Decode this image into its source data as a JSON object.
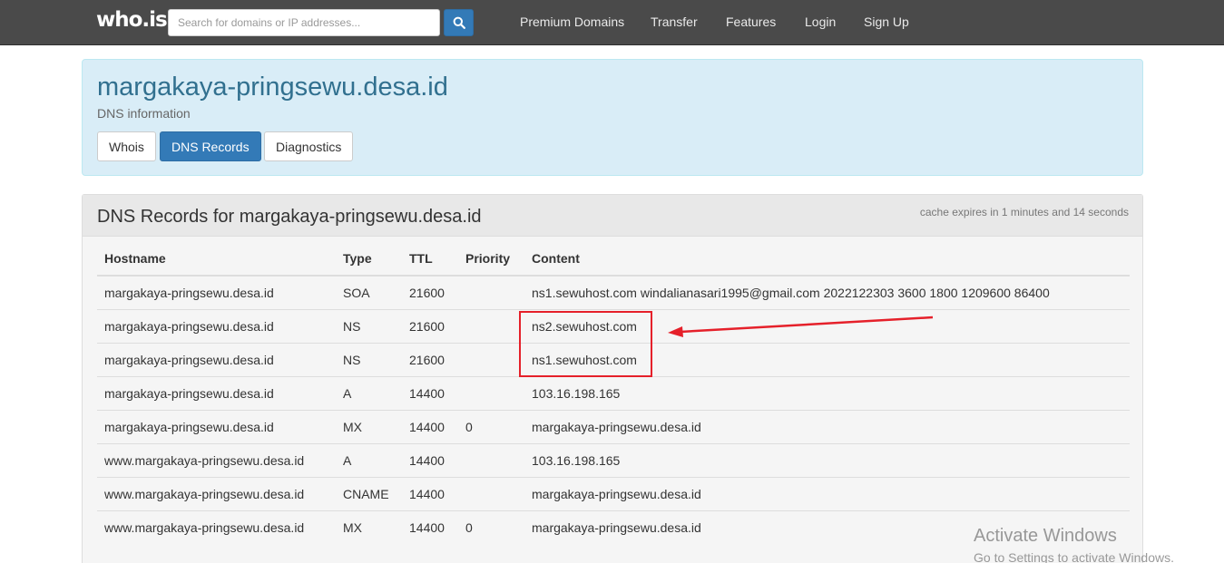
{
  "header": {
    "logo": "who.is",
    "search_placeholder": "Search for domains or IP addresses...",
    "nav": [
      "Premium Domains",
      "Transfer",
      "Features",
      "Login",
      "Sign Up"
    ]
  },
  "banner": {
    "domain": "margakaya-pringsewu.desa.id",
    "subtitle": "DNS information",
    "tabs": [
      "Whois",
      "DNS Records",
      "Diagnostics"
    ],
    "active_tab": "DNS Records"
  },
  "records": {
    "title": "DNS Records for margakaya-pringsewu.desa.id",
    "cache_note": "cache expires in 1 minutes and 14 seconds",
    "columns": [
      "Hostname",
      "Type",
      "TTL",
      "Priority",
      "Content"
    ],
    "rows": [
      [
        "margakaya-pringsewu.desa.id",
        "SOA",
        "21600",
        "",
        "ns1.sewuhost.com windalianasari1995@gmail.com 2022122303 3600 1800 1209600 86400"
      ],
      [
        "margakaya-pringsewu.desa.id",
        "NS",
        "21600",
        "",
        "ns2.sewuhost.com"
      ],
      [
        "margakaya-pringsewu.desa.id",
        "NS",
        "21600",
        "",
        "ns1.sewuhost.com"
      ],
      [
        "margakaya-pringsewu.desa.id",
        "A",
        "14400",
        "",
        "103.16.198.165"
      ],
      [
        "margakaya-pringsewu.desa.id",
        "MX",
        "14400",
        "0",
        "margakaya-pringsewu.desa.id"
      ],
      [
        "www.margakaya-pringsewu.desa.id",
        "A",
        "14400",
        "",
        "103.16.198.165"
      ],
      [
        "www.margakaya-pringsewu.desa.id",
        "CNAME",
        "14400",
        "",
        "margakaya-pringsewu.desa.id"
      ],
      [
        "www.margakaya-pringsewu.desa.id",
        "MX",
        "14400",
        "0",
        "margakaya-pringsewu.desa.id"
      ]
    ]
  },
  "watermark": {
    "line1": "Activate Windows",
    "line2": "Go to Settings to activate Windows."
  },
  "colors": {
    "topbar": "#4a4a4a",
    "accent": "#337ab7",
    "banner_bg": "#d9edf7",
    "annotation": "#e5202a"
  }
}
